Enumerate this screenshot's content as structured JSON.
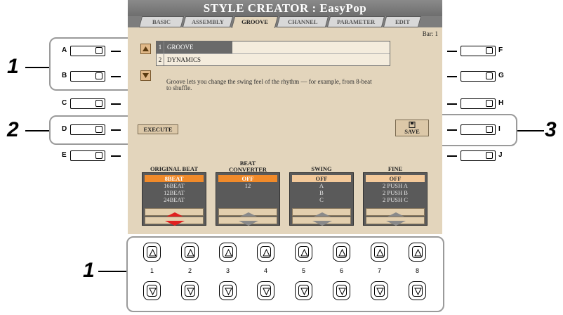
{
  "screen": {
    "title": "STYLE CREATOR : EasyPop",
    "tabs": [
      "BASIC",
      "ASSEMBLY",
      "GROOVE",
      "CHANNEL",
      "PARAMETER",
      "EDIT"
    ],
    "active_tab": "GROOVE",
    "bar_text": "Bar:  1",
    "menu": [
      {
        "num": "1",
        "label": "GROOVE"
      },
      {
        "num": "2",
        "label": "DYNAMICS"
      }
    ],
    "description": "Groove lets you change the swing feel of the rhythm — for example, from 8-beat to shuffle.",
    "execute_label": "EXECUTE",
    "save_label": "SAVE",
    "columns": [
      {
        "title": "ORIGINAL BEAT",
        "items": [
          "8BEAT",
          "16BEAT",
          "12BEAT",
          "24BEAT"
        ],
        "selected": 0
      },
      {
        "title": "BEAT\nCONVERTER",
        "items": [
          "OFF",
          "12"
        ],
        "selected": 0
      },
      {
        "title": "SWING",
        "items": [
          "OFF",
          "A",
          "B",
          "C"
        ],
        "selected": 0
      },
      {
        "title": "FINE",
        "items": [
          "OFF",
          "2 PUSH A",
          "2 PUSH B",
          "2 PUSH C"
        ],
        "selected": 0
      }
    ]
  },
  "side_buttons": {
    "left": [
      "A",
      "B",
      "C",
      "D",
      "E"
    ],
    "right": [
      "F",
      "G",
      "H",
      "I",
      "J"
    ]
  },
  "callouts": [
    "1",
    "2",
    "3",
    "1"
  ],
  "bottom_buttons": [
    "1",
    "2",
    "3",
    "4",
    "5",
    "6",
    "7",
    "8"
  ],
  "colors": {
    "screen_bg": "#e3d5bc",
    "title_bg": "#7a7a7a",
    "highlight": "#f08a2a",
    "arrow_red": "#e02020"
  }
}
